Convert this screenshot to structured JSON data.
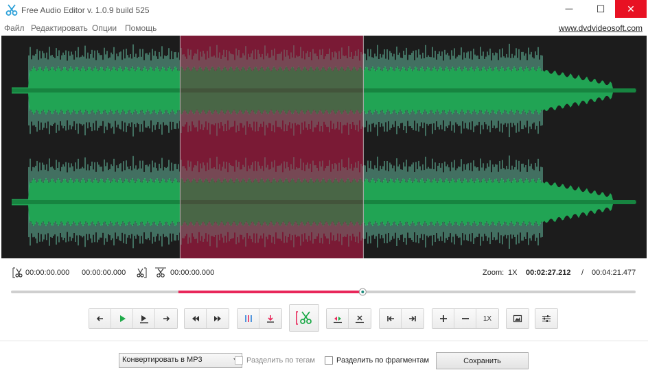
{
  "window": {
    "title": "Free Audio Editor v. 1.0.9 build 525",
    "minimize": "—",
    "maximize": "☐",
    "close": "✕"
  },
  "menu": {
    "items": [
      "Файл",
      "Редактировать",
      "Опции",
      "Помощь"
    ],
    "site_link": "www.dvdvideosoft.com"
  },
  "colors": {
    "wave_background": "#1c1c1c",
    "wave_fill": "#21a454",
    "wave_peak": "#6fcfb0",
    "selection_fill": "#7a1a35",
    "seek_fill": "#e8275a",
    "close_red": "#e81123"
  },
  "selection": {
    "start_fraction": 0.277,
    "end_fraction": 0.561
  },
  "timecodes": {
    "selection_start": "00:00:00.000",
    "selection_end": "00:00:00.000",
    "cut_point": "00:00:00.000",
    "zoom_label": "Zoom:",
    "zoom_value": "1X",
    "position": "00:02:27.212",
    "separator": "/",
    "duration": "00:04:21.477"
  },
  "seek": {
    "filled_from_fraction": 0.268,
    "position_fraction": 0.563
  },
  "toolbar": {
    "zoom_reset_label": "1X"
  },
  "bottom": {
    "format_select": "Конвертировать в MP3",
    "split_by_tags": "Разделить по тегам",
    "split_by_fragments": "Разделить по фрагментам",
    "save_button": "Сохранить"
  }
}
